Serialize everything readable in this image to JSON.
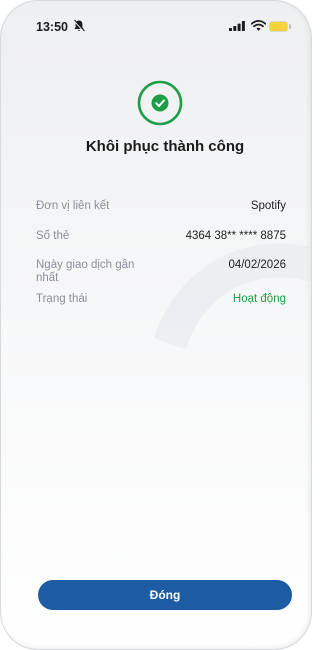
{
  "status_bar": {
    "time": "13:50"
  },
  "icons": {
    "bell": "bell-muted-icon",
    "signal": "signal-icon",
    "wifi": "wifi-icon",
    "battery": "battery-icon",
    "success": "checkmark-circle-icon"
  },
  "colors": {
    "success_green": "#1e9e47",
    "primary_blue": "#1d5ba3"
  },
  "title": "Khôi phục thành công",
  "details": [
    {
      "label": "Đơn vị liên kết",
      "value": "Spotify"
    },
    {
      "label": "Số thẻ",
      "value": "4364 38** **** 8875"
    },
    {
      "label": "Ngày giao dịch gần nhất",
      "value": "04/02/2026"
    },
    {
      "label": "Trạng thái",
      "value": "Hoạt động"
    }
  ],
  "close_button": {
    "label": "Đóng"
  }
}
